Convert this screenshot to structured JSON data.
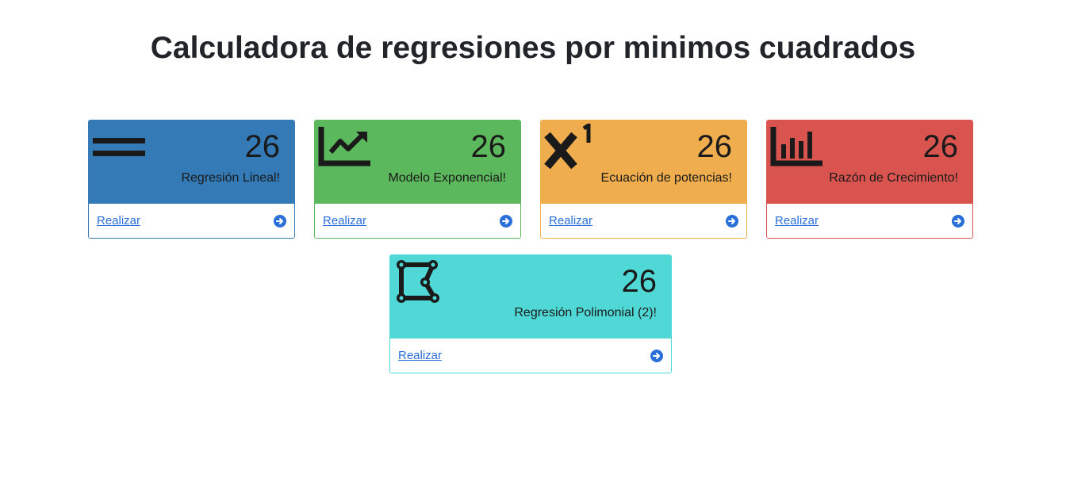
{
  "page": {
    "title": "Calculadora de regresiones por minimos cuadrados"
  },
  "cards": [
    {
      "count": "26",
      "label": "Regresión Lineal!",
      "link": "Realizar",
      "icon": "equals-bars-icon",
      "color": "#337ab7"
    },
    {
      "count": "26",
      "label": "Modelo Exponencial!",
      "link": "Realizar",
      "icon": "trending-chart-icon",
      "color": "#5cb85c"
    },
    {
      "count": "26",
      "label": "Ecuación de potencias!",
      "link": "Realizar",
      "icon": "superscript-x-icon",
      "color": "#f0ad4e"
    },
    {
      "count": "26",
      "label": "Razón de Crecimiento!",
      "link": "Realizar",
      "icon": "bar-chart-icon",
      "color": "#d9534f"
    },
    {
      "count": "26",
      "label": "Regresión Polimonial (2)!",
      "link": "Realizar",
      "icon": "polygon-vector-icon",
      "color": "#50d8d7"
    }
  ],
  "colors": {
    "link": "#2a6ed8",
    "icon_dark": "#1a1a1a"
  }
}
